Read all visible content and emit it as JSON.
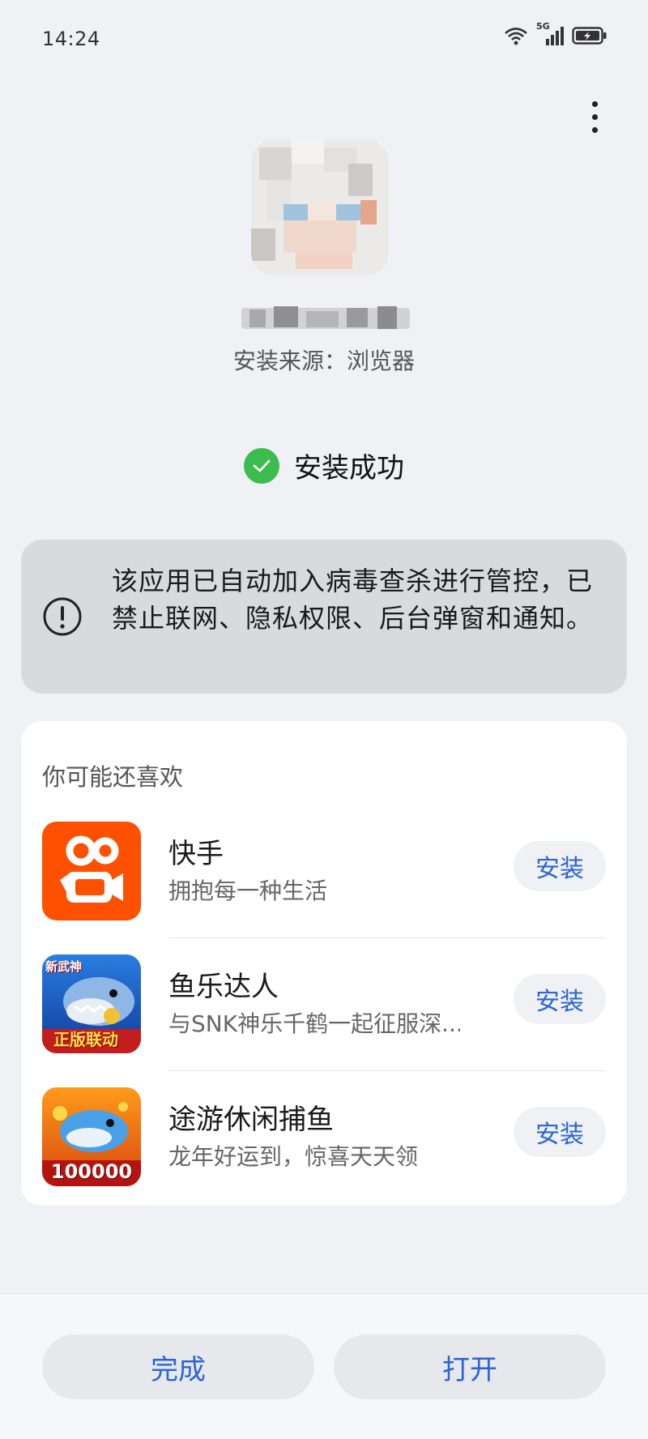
{
  "status_bar": {
    "time": "14:24",
    "network_label": "5G",
    "icons": [
      "wifi-icon",
      "signal-icon",
      "battery-charging-icon"
    ]
  },
  "header": {
    "more_icon": "more-vert-icon"
  },
  "app": {
    "icon": "app-avatar-icon",
    "install_source": "安装来源：浏览器"
  },
  "status": {
    "icon": "check-circle-icon",
    "text": "安装成功",
    "color": "#3cbc4e"
  },
  "warning": {
    "icon": "exclamation-circle-icon",
    "text": "该应用已自动加入病毒查杀进行管控，已禁止联网、隐私权限、后台弹窗和通知。"
  },
  "recommendations": {
    "title": "你可能还喜欢",
    "items": [
      {
        "name": "快手",
        "desc": "拥抱每一种生活",
        "button": "安装",
        "icon": "kuaishou-icon"
      },
      {
        "name": "鱼乐达人",
        "desc": "与SNK神乐千鹤一起征服深...",
        "button": "安装",
        "icon": "fish-game-icon",
        "badge_top": "新武神",
        "badge_bottom": "正版联动"
      },
      {
        "name": "途游休闲捕鱼",
        "desc": "龙年好运到，惊喜天天领",
        "button": "安装",
        "icon": "fishing-game-icon",
        "badge": "100000"
      }
    ]
  },
  "footer": {
    "done_label": "完成",
    "open_label": "打开",
    "accent": "#2a64d8"
  }
}
